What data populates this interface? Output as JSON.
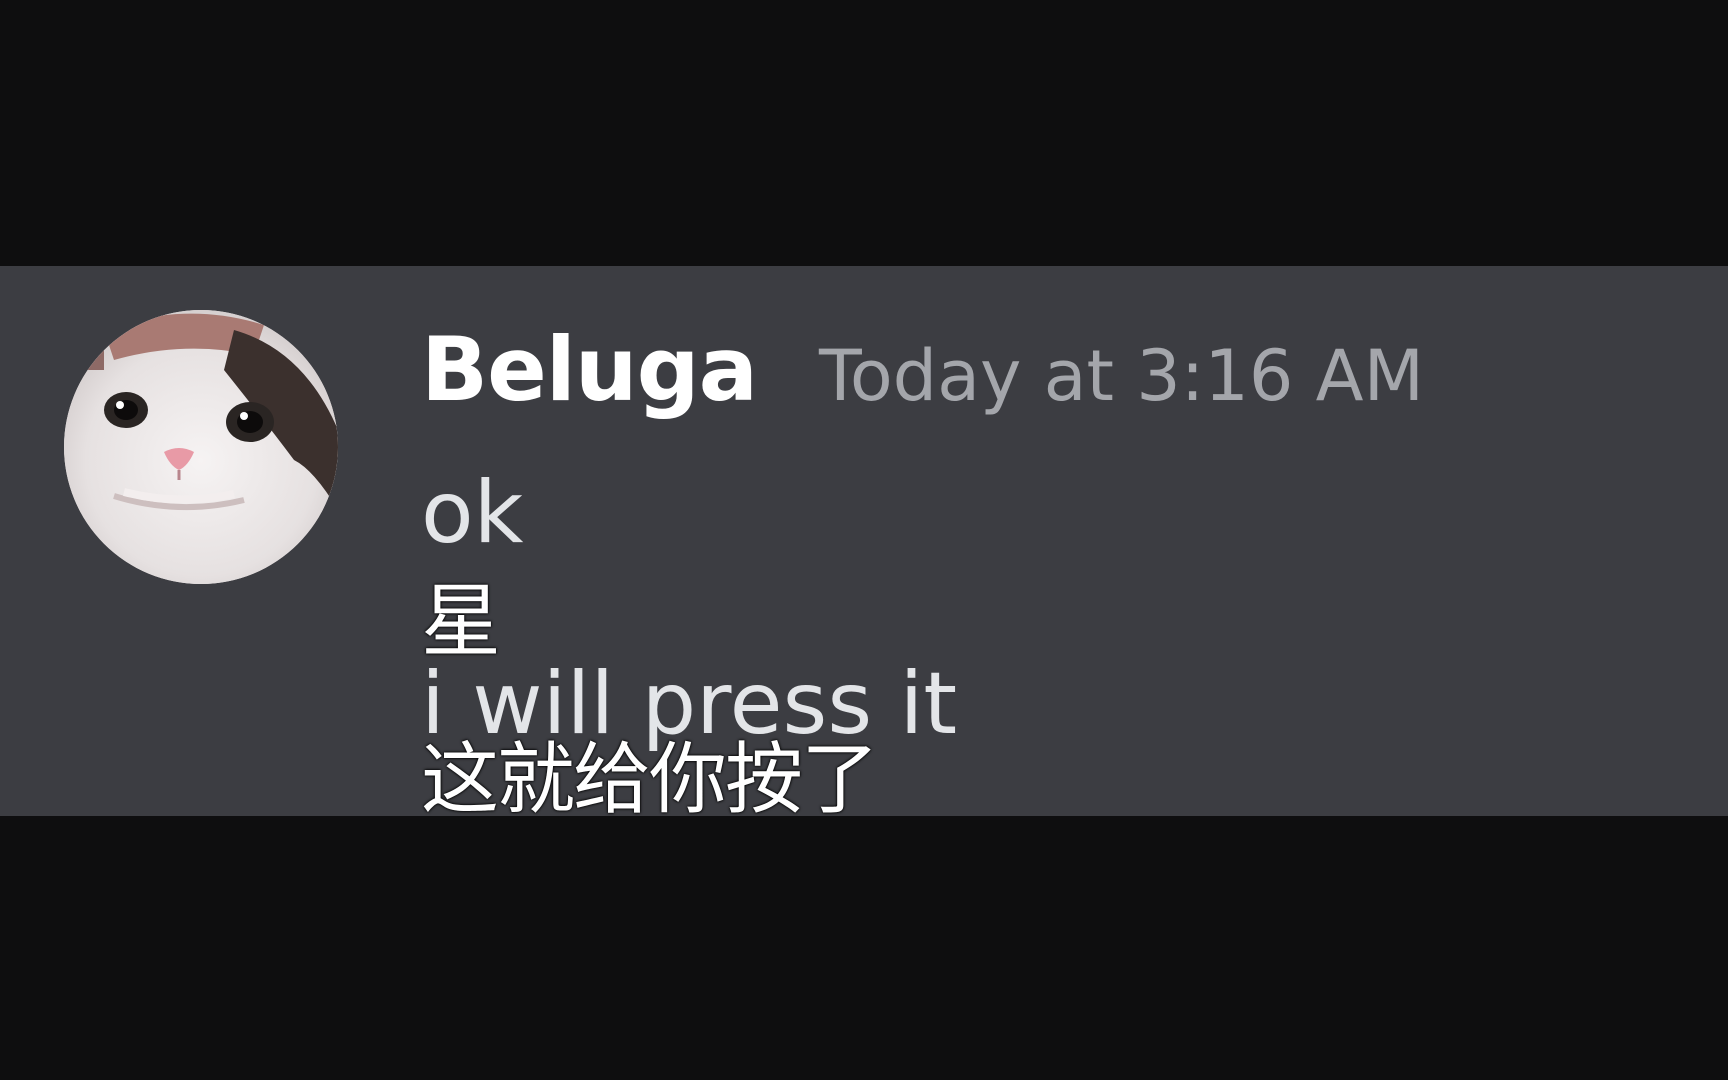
{
  "message": {
    "username": "Beluga",
    "timestamp": "Today at 3:16 AM",
    "avatar_icon": "cat-avatar-icon",
    "lines": [
      "ok",
      "i will press it"
    ]
  },
  "subtitles": [
    "星",
    "这就给你按了"
  ],
  "colors": {
    "background": "#0e0e0f",
    "panel": "#3c3d42",
    "username": "#ffffff",
    "timestamp": "#a4a6ab",
    "message_text": "#e3e5e8"
  }
}
